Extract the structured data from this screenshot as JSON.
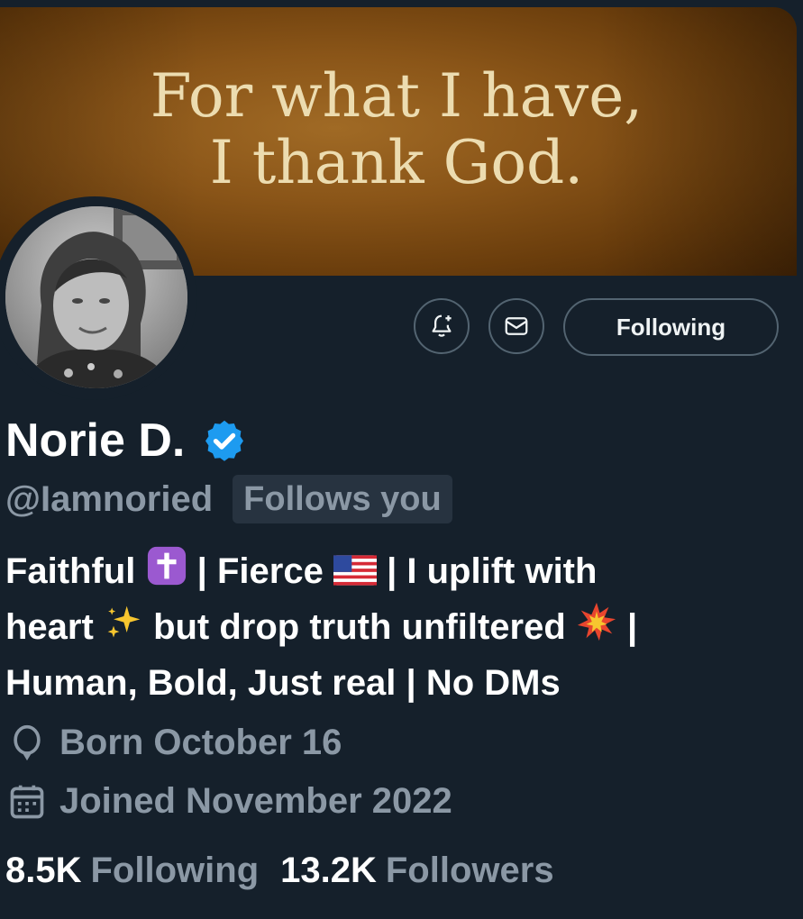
{
  "banner": {
    "quote_line1": "For what I have,",
    "quote_line2": "I thank God."
  },
  "profile": {
    "display_name": "Norie D.",
    "handle": "@Iamnoried",
    "follows_you_label": "Follows you",
    "bio": {
      "line1_a": "Faithful",
      "line1_b": "| Fierce",
      "line1_c": "| I uplift with",
      "line2_a": "heart",
      "line2_b": "but drop truth unfiltered",
      "line2_c": "|",
      "line3": "Human, Bold, Just real | No DMs"
    },
    "birthday": "Born October 16",
    "joined": "Joined November 2022"
  },
  "actions": {
    "notify_icon": "bell-plus-icon",
    "message_icon": "envelope-icon",
    "following_label": "Following"
  },
  "stats": {
    "following_count": "8.5K",
    "following_label": "Following",
    "followers_count": "13.2K",
    "followers_label": "Followers"
  },
  "colors": {
    "background": "#15202b",
    "secondary_text": "#8b98a5",
    "verified_blue": "#1d9bf0",
    "border": "#536471"
  }
}
